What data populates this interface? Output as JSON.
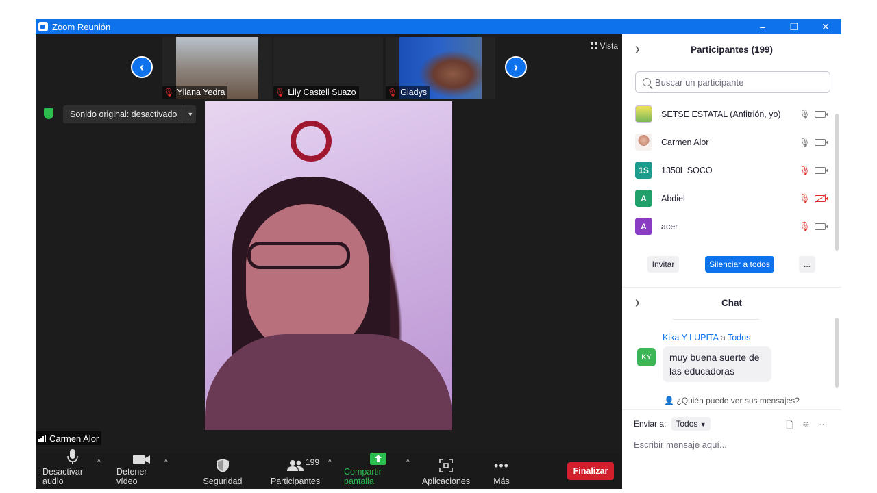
{
  "window": {
    "title": "Zoom Reunión",
    "controls": [
      "–",
      "❐",
      "✕"
    ]
  },
  "thumbnails": [
    {
      "name": "Yliana Yedra"
    },
    {
      "name": "Lily Castell Suazo"
    },
    {
      "name": "Gladys"
    }
  ],
  "stage": {
    "view_label": "Vista",
    "original_sound": "Sonido original: desactivado",
    "active_speaker": "Carmen Alor"
  },
  "toolbar": {
    "audio": "Desactivar audio",
    "video": "Detener vídeo",
    "security": "Seguridad",
    "participants": "Participantes",
    "participants_count": "199",
    "share": "Compartir pantalla",
    "apps": "Aplicaciones",
    "more": "Más",
    "end": "Finalizar"
  },
  "participants_panel": {
    "title": "Participantes (199)",
    "search_placeholder": "Buscar un participante",
    "list": [
      {
        "name": "SETSE ESTATAL (Anfitrión, yo)",
        "avatar": "",
        "mic": "on",
        "cam": "on"
      },
      {
        "name": "Carmen Alor",
        "avatar": "",
        "mic": "on",
        "cam": "on"
      },
      {
        "name": "1350L SOCO",
        "avatar": "1S",
        "mic": "muted",
        "cam": "on"
      },
      {
        "name": "Abdiel",
        "avatar": "A",
        "mic": "muted",
        "cam": "off"
      },
      {
        "name": "acer",
        "avatar": "A",
        "mic": "muted",
        "cam": "on"
      }
    ],
    "invite": "Invitar",
    "mute_all": "Silenciar a todos",
    "more": "..."
  },
  "chat": {
    "title": "Chat",
    "message": {
      "sender": "Kika Y LUPITA",
      "to_word": "a",
      "recipient": "Todos",
      "initials": "KY",
      "text": "muy buena suerte de las educadoras"
    },
    "who_can_see": "¿Quién puede ver sus mensajes?",
    "send_to_label": "Enviar a:",
    "send_to_value": "Todos",
    "compose_placeholder": "Escribir mensaje aquí..."
  },
  "colors": {
    "zoom_blue": "#0e72ed",
    "end_red": "#d1202c",
    "share_green": "#2dbd4e",
    "muted_red": "#e02828"
  }
}
